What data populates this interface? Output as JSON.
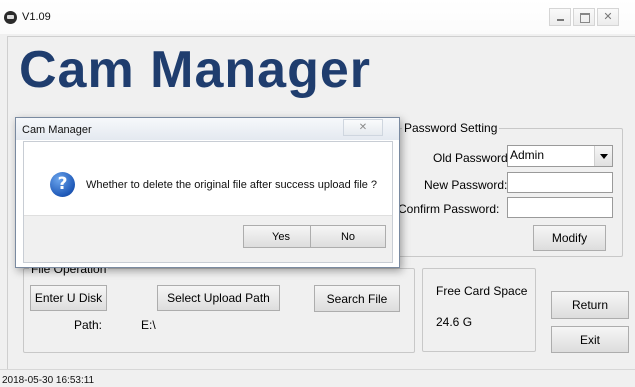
{
  "window": {
    "title": "V1.09",
    "brand": "Cam Manager"
  },
  "password_setting": {
    "legend": "Password Setting",
    "old_password_label": "Old Password",
    "old_password_value": "Admin",
    "new_password_label": "New Password:",
    "confirm_password_label": "Confirm Password:",
    "modify_label": "Modify"
  },
  "file_operation": {
    "legend": "File Operation",
    "enter_u_disk_label": "Enter U Disk",
    "select_upload_path_label": "Select Upload Path",
    "search_file_label": "Search File",
    "path_label": "Path:",
    "path_value": "E:\\"
  },
  "free_space": {
    "label": "Free Card Space",
    "value": "24.6 G"
  },
  "actions": {
    "return_label": "Return",
    "exit_label": "Exit"
  },
  "status_bar": {
    "timestamp": "2018-05-30 16:53:11"
  },
  "dialog": {
    "title": "Cam Manager",
    "message": "Whether to delete the original file after success upload file ?",
    "yes_label": "Yes",
    "no_label": "No"
  },
  "icons": {
    "dialog_icon": "question-icon",
    "app_icon": "camera-icon"
  }
}
